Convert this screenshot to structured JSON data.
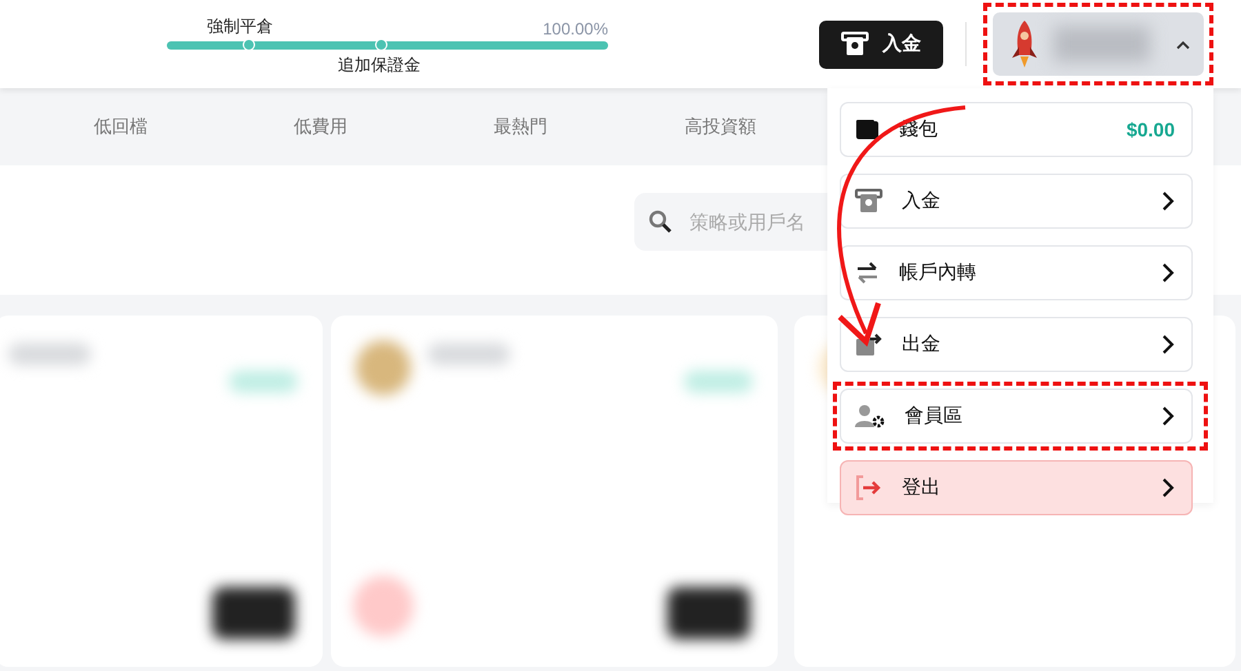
{
  "margin_meter": {
    "liquidation_label": "強制平倉",
    "margin_call_label": "追加保證金",
    "reading": "100.00%",
    "level": 1
  },
  "header": {
    "deposit_button": "入金",
    "account": {
      "expanded": true,
      "highlighted": true
    }
  },
  "account_menu": [
    {
      "kind": "wallet",
      "label": "錢包",
      "value": "$0.00",
      "highlighted": false
    },
    {
      "kind": "deposit",
      "label": "入金",
      "highlighted": false
    },
    {
      "kind": "transfer",
      "label": "帳戶內轉",
      "highlighted": false
    },
    {
      "kind": "withdraw",
      "label": "出金",
      "highlighted": false
    },
    {
      "kind": "member",
      "label": "會員區",
      "highlighted": true
    },
    {
      "kind": "logout",
      "label": "登出",
      "highlighted": false
    }
  ],
  "filter_tabs": [
    {
      "label": "低回檔",
      "selected": false
    },
    {
      "label": "低費用",
      "selected": false
    },
    {
      "label": "最熱門",
      "selected": false
    },
    {
      "label": "高投資額",
      "selected": false
    }
  ],
  "search": {
    "placeholder": "策略或用戶名"
  }
}
